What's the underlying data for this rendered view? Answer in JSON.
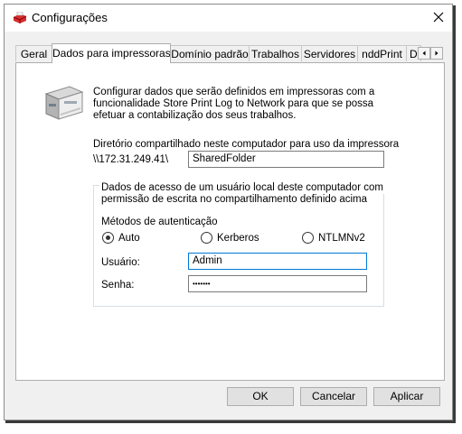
{
  "window": {
    "title": "Configurações"
  },
  "tabs": [
    "Geral",
    "Dados para impressoras",
    "Domínio padrão",
    "Trabalhos",
    "Servidores",
    "nddPrint",
    "D"
  ],
  "active_tab": "Dados para impressoras",
  "panel": {
    "intro_lines": [
      "Configurar dados que serão definidos em impressoras com a",
      "funcionalidade Store Print Log to Network para que se possa",
      "efetuar a contabilização dos seus trabalhos."
    ],
    "shared_dir_label": "Diretório compartilhado neste computador para uso da impressora",
    "share_prefix": "\\\\172.31.249.41\\",
    "share_value": "SharedFolder",
    "group_lines": [
      "Dados de acesso de um usuário local deste computador com",
      "permissão de escrita no compartilhamento definido acima"
    ],
    "auth_methods_label": "Métodos de autenticação",
    "auth_options": [
      "Auto",
      "Kerberos",
      "NTLMNv2"
    ],
    "auth_selected": "Auto",
    "user_label": "Usuário:",
    "user_value": "Admin",
    "password_label": "Senha:",
    "password_value": "•••••••"
  },
  "buttons": {
    "ok": "OK",
    "cancel": "Cancelar",
    "apply": "Aplicar"
  },
  "colors": {
    "focus_border": "#0078d7",
    "window_bg": "#f0f0f0"
  }
}
